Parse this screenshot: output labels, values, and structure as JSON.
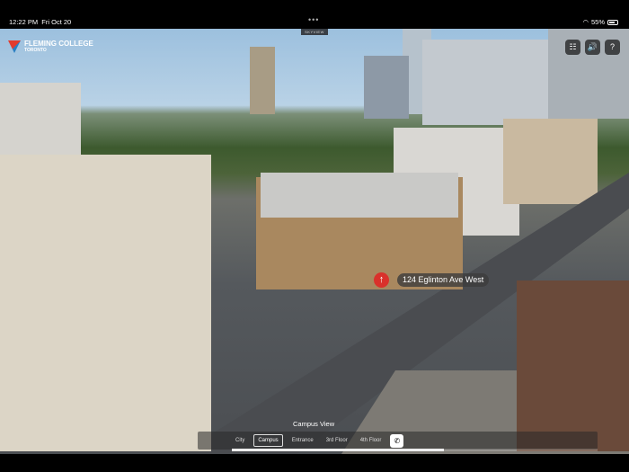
{
  "status_bar": {
    "time": "12:22 PM",
    "date": "Fri Oct 20",
    "battery": "55%",
    "dots": "•••"
  },
  "app": {
    "badge": "SKYVIEW",
    "logo_line1": "FLEMING COLLEGE",
    "logo_line2": "TORONTO"
  },
  "toolbar": {
    "icons": [
      "list-icon",
      "speaker-icon",
      "help-icon"
    ],
    "list": "☷",
    "sound": "🔊",
    "help": "?"
  },
  "hotspot": {
    "label": "124 Eglinton Ave West",
    "arrow": "↑"
  },
  "view_title": "Campus View",
  "nav": {
    "items": [
      "City",
      "Campus",
      "Entrance",
      "3rd Floor",
      "4th Floor"
    ],
    "active": "Campus",
    "phone": "✆",
    "progress_percent": 58
  },
  "colors": {
    "pin": "#d9312b"
  }
}
